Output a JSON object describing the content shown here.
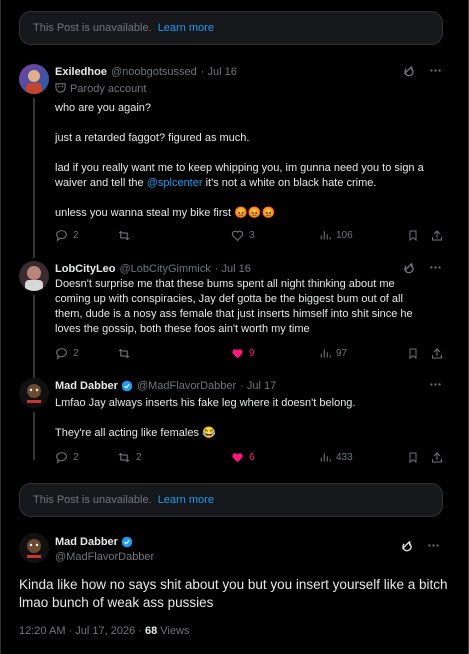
{
  "unavailable_1": {
    "text": "This Post is unavailable.",
    "link": "Learn more"
  },
  "unavailable_2": {
    "text": "This Post is unavailable.",
    "link": "Learn more"
  },
  "tweets": [
    {
      "name": "Exiledhoe",
      "handle": "@noobgotsussed",
      "date": "· Jul 16",
      "badge": "Parody account",
      "lines": [
        "who are you again?",
        "just a retarded faggot? figured as much.",
        "lad if you really want me to keep whipping you, im gunna need you to sign a",
        "waiver and tell the ",
        "@splcenter",
        " it's not a white on black hate crime.",
        "unless you wanna steal my bike first 😡😡😡"
      ],
      "replies": "2",
      "reposts": "",
      "likes": "3",
      "views": "106"
    },
    {
      "name": "LobCityLeo",
      "handle": "@LobCityGimmick",
      "date": "· Jul 16",
      "lines": [
        "Doesn't surprise me that these bums spent all night thinking about me",
        "coming up with conspiracies, Jay def gotta be the biggest bum out of all",
        "them, dude is a nosy ass female that just inserts himself into shit since he",
        "loves the gossip, both these foos ain't worth my time"
      ],
      "replies": "2",
      "reposts": "",
      "likes": "9",
      "views": "97"
    },
    {
      "name": "Mad Dabber",
      "handle": "@MadFlavorDabber",
      "date": "· Jul 17",
      "lines": [
        "Lmfao Jay always inserts his fake leg where it doesn't belong.",
        "They're all acting like females 😂"
      ],
      "replies": "2",
      "reposts": "2",
      "likes": "6",
      "views": "433"
    }
  ],
  "main": {
    "name": "Mad Dabber",
    "handle": "@MadFlavorDabber",
    "text_line1": "Kinda like how no says shit about you but you insert yourself like a bitch",
    "text_line2": "lmao bunch of weak ass pussies",
    "timestamp": "12:20 AM · Jul 17, 2026 · ",
    "views_count": "68",
    "views_label": " Views"
  },
  "colors": {
    "accent": "#1d9bf0",
    "like": "#f91880",
    "muted": "#71767b",
    "border": "#2f3336"
  },
  "icons": [
    "grok-icon",
    "more-icon",
    "reply-icon",
    "repost-icon",
    "like-icon",
    "views-icon",
    "bookmark-icon",
    "share-icon",
    "verified-icon",
    "parody-icon"
  ]
}
